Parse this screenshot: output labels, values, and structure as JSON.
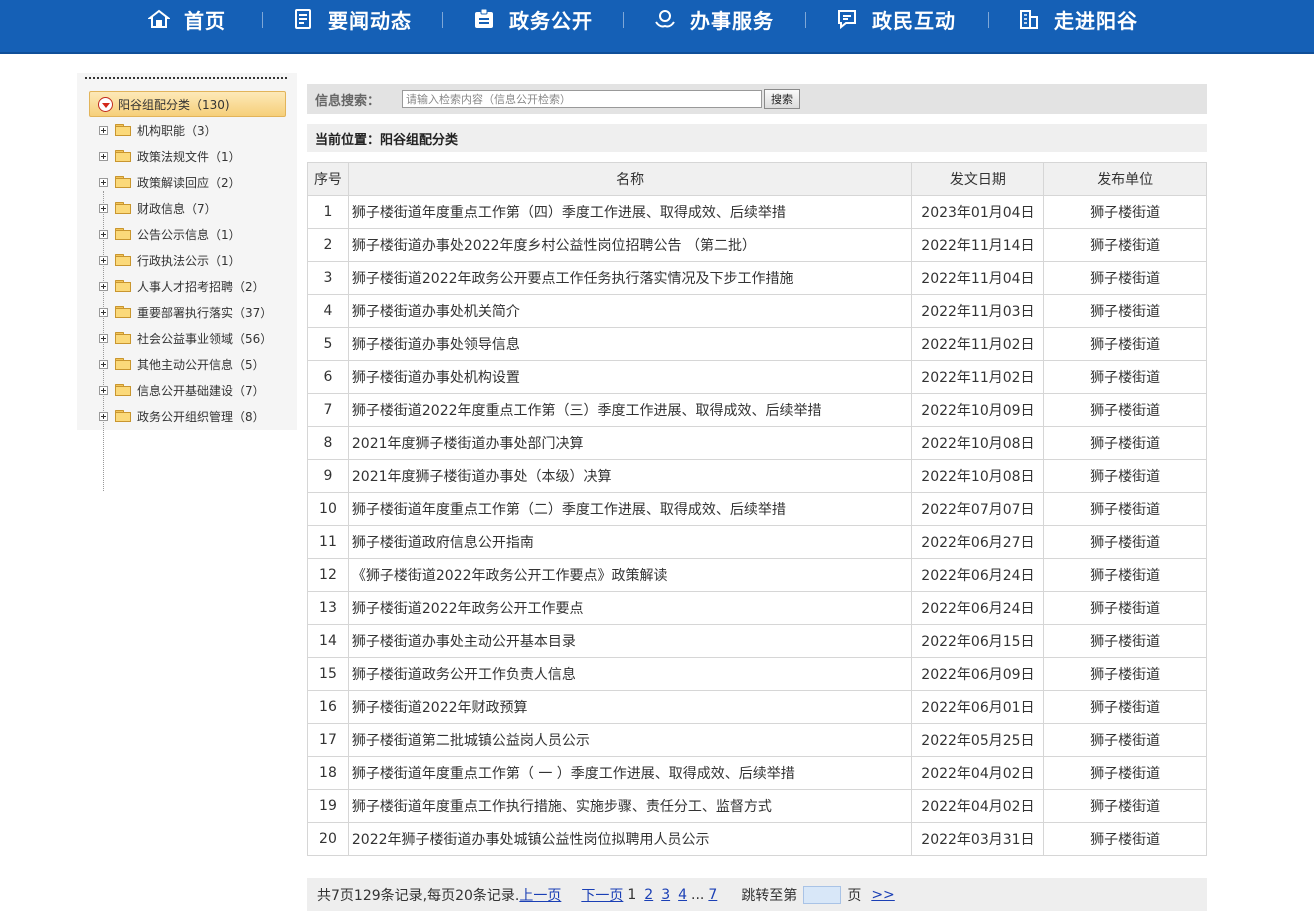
{
  "nav": {
    "items": [
      {
        "label": "首页",
        "icon": "home-icon"
      },
      {
        "label": "要闻动态",
        "icon": "news-document-icon"
      },
      {
        "label": "政务公开",
        "icon": "government-board-icon"
      },
      {
        "label": "办事服务",
        "icon": "service-hands-icon"
      },
      {
        "label": "政民互动",
        "icon": "chat-bubble-icon"
      },
      {
        "label": "走进阳谷",
        "icon": "building-icon"
      }
    ],
    "background_color": "#1560b6"
  },
  "sidebar": {
    "root": {
      "label": "阳谷组配分类（130)"
    },
    "items": [
      {
        "label": "机构职能（3）"
      },
      {
        "label": "政策法规文件（1）"
      },
      {
        "label": "政策解读回应（2）"
      },
      {
        "label": "财政信息（7）"
      },
      {
        "label": "公告公示信息（1）"
      },
      {
        "label": "行政执法公示（1）"
      },
      {
        "label": "人事人才招考招聘（2）"
      },
      {
        "label": "重要部署执行落实（37）"
      },
      {
        "label": "社会公益事业领域（56）"
      },
      {
        "label": "其他主动公开信息（5）"
      },
      {
        "label": "信息公开基础建设（7）"
      },
      {
        "label": "政务公开组织管理（8）"
      }
    ]
  },
  "search": {
    "label": "信息搜索：",
    "placeholder": "请输入检索内容（信息公开检索）",
    "button_label": "搜索"
  },
  "breadcrumb": {
    "text": "当前位置：阳谷组配分类"
  },
  "table": {
    "headers": {
      "no": "序号",
      "title": "名称",
      "date": "发文日期",
      "unit": "发布单位"
    },
    "rows": [
      {
        "no": "1",
        "title": "狮子楼街道年度重点工作第（四）季度工作进展、取得成效、后续举措",
        "date": "2023年01月04日",
        "unit": "狮子楼街道"
      },
      {
        "no": "2",
        "title": "狮子楼街道办事处2022年度乡村公益性岗位招聘公告 （第二批）",
        "date": "2022年11月14日",
        "unit": "狮子楼街道"
      },
      {
        "no": "3",
        "title": "狮子楼街道2022年政务公开要点工作任务执行落实情况及下步工作措施",
        "date": "2022年11月04日",
        "unit": "狮子楼街道"
      },
      {
        "no": "4",
        "title": "狮子楼街道办事处机关简介",
        "date": "2022年11月03日",
        "unit": "狮子楼街道"
      },
      {
        "no": "5",
        "title": "狮子楼街道办事处领导信息",
        "date": "2022年11月02日",
        "unit": "狮子楼街道"
      },
      {
        "no": "6",
        "title": "狮子楼街道办事处机构设置",
        "date": "2022年11月02日",
        "unit": "狮子楼街道"
      },
      {
        "no": "7",
        "title": "狮子楼街道2022年度重点工作第（三）季度工作进展、取得成效、后续举措",
        "date": "2022年10月09日",
        "unit": "狮子楼街道"
      },
      {
        "no": "8",
        "title": "2021年度狮子楼街道办事处部门决算",
        "date": "2022年10月08日",
        "unit": "狮子楼街道"
      },
      {
        "no": "9",
        "title": "2021年度狮子楼街道办事处（本级）决算",
        "date": "2022年10月08日",
        "unit": "狮子楼街道"
      },
      {
        "no": "10",
        "title": "狮子楼街道年度重点工作第（二）季度工作进展、取得成效、后续举措",
        "date": "2022年07月07日",
        "unit": "狮子楼街道"
      },
      {
        "no": "11",
        "title": "狮子楼街道政府信息公开指南",
        "date": "2022年06月27日",
        "unit": "狮子楼街道"
      },
      {
        "no": "12",
        "title": "《狮子楼街道2022年政务公开工作要点》政策解读",
        "date": "2022年06月24日",
        "unit": "狮子楼街道"
      },
      {
        "no": "13",
        "title": "狮子楼街道2022年政务公开工作要点",
        "date": "2022年06月24日",
        "unit": "狮子楼街道"
      },
      {
        "no": "14",
        "title": "狮子楼街道办事处主动公开基本目录",
        "date": "2022年06月15日",
        "unit": "狮子楼街道"
      },
      {
        "no": "15",
        "title": "狮子楼街道政务公开工作负责人信息",
        "date": "2022年06月09日",
        "unit": "狮子楼街道"
      },
      {
        "no": "16",
        "title": "狮子楼街道2022年财政预算",
        "date": "2022年06月01日",
        "unit": "狮子楼街道"
      },
      {
        "no": "17",
        "title": "狮子楼街道第二批城镇公益岗人员公示",
        "date": "2022年05月25日",
        "unit": "狮子楼街道"
      },
      {
        "no": "18",
        "title": "狮子楼街道年度重点工作第（ 一 ）季度工作进展、取得成效、后续举措",
        "date": "2022年04月02日",
        "unit": "狮子楼街道"
      },
      {
        "no": "19",
        "title": "狮子楼街道年度重点工作执行措施、实施步骤、责任分工、监督方式",
        "date": "2022年04月02日",
        "unit": "狮子楼街道"
      },
      {
        "no": "20",
        "title": "2022年狮子楼街道办事处城镇公益性岗位拟聘用人员公示",
        "date": "2022年03月31日",
        "unit": "狮子楼街道"
      }
    ]
  },
  "pager": {
    "summary": "共7页129条记录,每页20条记录.",
    "prev_label": "上一页",
    "next_label": "下一页",
    "current_page": "1",
    "pages": [
      "2",
      "3",
      "4"
    ],
    "ellipsis": "...",
    "last_page": "7",
    "goto_label": "跳转至第",
    "goto_suffix": "页",
    "go_label": ">>"
  }
}
